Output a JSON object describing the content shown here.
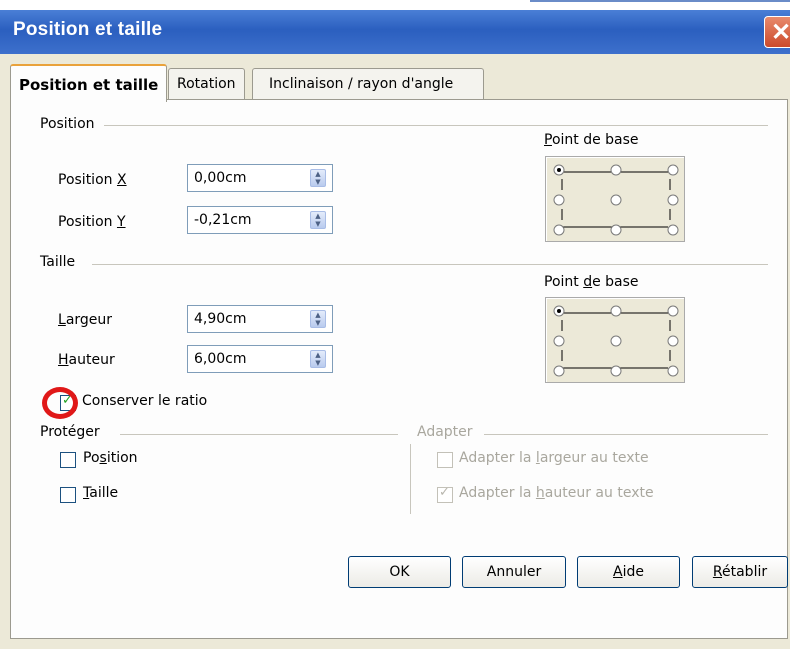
{
  "window": {
    "title": "Position et taille"
  },
  "tabs": [
    {
      "label": "Position et taille",
      "active": true
    },
    {
      "label": "Rotation",
      "active": false
    },
    {
      "label": "Inclinaison / rayon d'angle",
      "active": false
    }
  ],
  "position": {
    "section_label": "Position",
    "x_label": "Position X",
    "x_value": "0,00cm",
    "y_label": "Position Y",
    "y_value": "-0,21cm",
    "base_point_label": "Point de base"
  },
  "size": {
    "section_label": "Taille",
    "width_label": "Largeur",
    "width_value": "4,90cm",
    "height_label": "Hauteur",
    "height_value": "6,00cm",
    "base_point_label": "Point de base",
    "keep_ratio_label": "Conserver le ratio",
    "keep_ratio_checked": true
  },
  "protect": {
    "section_label": "Protéger",
    "position_label": "Position",
    "position_checked": false,
    "size_label": "Taille",
    "size_checked": false
  },
  "adapt": {
    "section_label": "Adapter",
    "width_label": "Adapter la largeur au texte",
    "width_checked": false,
    "height_label": "Adapter la hauteur au texte",
    "height_checked": true
  },
  "buttons": {
    "ok": "OK",
    "cancel": "Annuler",
    "help": "Aide",
    "reset": "Rétablir"
  },
  "icons": {
    "close": "close-icon",
    "spin": "spin-arrows-icon",
    "check": "checkmark-icon"
  },
  "colors": {
    "titlebar": "#2b5fbf",
    "dialog_bg": "#ece9d8",
    "highlight_circle": "#e01818"
  }
}
